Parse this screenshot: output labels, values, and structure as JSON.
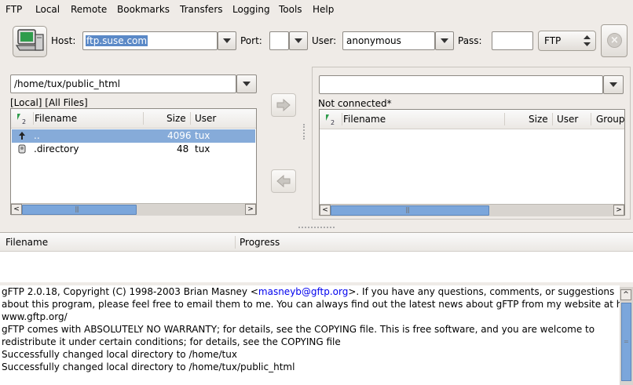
{
  "menu": [
    "FTP",
    "Local",
    "Remote",
    "Bookmarks",
    "Transfers",
    "Logging",
    "Tools",
    "Help"
  ],
  "toolbar": {
    "host_label": "Host:",
    "host_value": "ftp.suse.com",
    "port_label": "Port:",
    "port_value": "",
    "user_label": "User:",
    "user_value": "anonymous",
    "pass_label": "Pass:",
    "pass_value": "",
    "protocol": "FTP"
  },
  "local": {
    "path": "/home/tux/public_html",
    "status": "[Local] [All Files]",
    "columns": [
      "Filename",
      "Size",
      "User"
    ],
    "rows": [
      {
        "name": "..",
        "size": "4096",
        "user": "tux"
      },
      {
        "name": ".directory",
        "size": "48",
        "user": "tux"
      }
    ]
  },
  "remote": {
    "path": "",
    "status": "Not connected*",
    "columns": [
      "Filename",
      "Size",
      "User",
      "Group"
    ]
  },
  "transfers": {
    "columns": [
      "Filename",
      "Progress"
    ]
  },
  "log": {
    "line1_pre": "gFTP 2.0.18, Copyright (C) 1998-2003 Brian Masney <",
    "line1_link": "masneyb@gftp.org",
    "line1_post": ">. If you have any questions, comments, or suggestions",
    "line2": "about this program, please feel free to email them to me. You can always find out the latest news about gFTP from my website at http://",
    "line3": "www.gftp.org/",
    "line4": "gFTP comes with ABSOLUTELY NO WARRANTY; for details, see the COPYING file. This is free software, and you are welcome to",
    "line5": "redistribute it under certain conditions; for details, see the COPYING file",
    "line6": "Successfully changed local directory to /home/tux",
    "line7": "Successfully changed local directory to /home/tux/public_html"
  }
}
